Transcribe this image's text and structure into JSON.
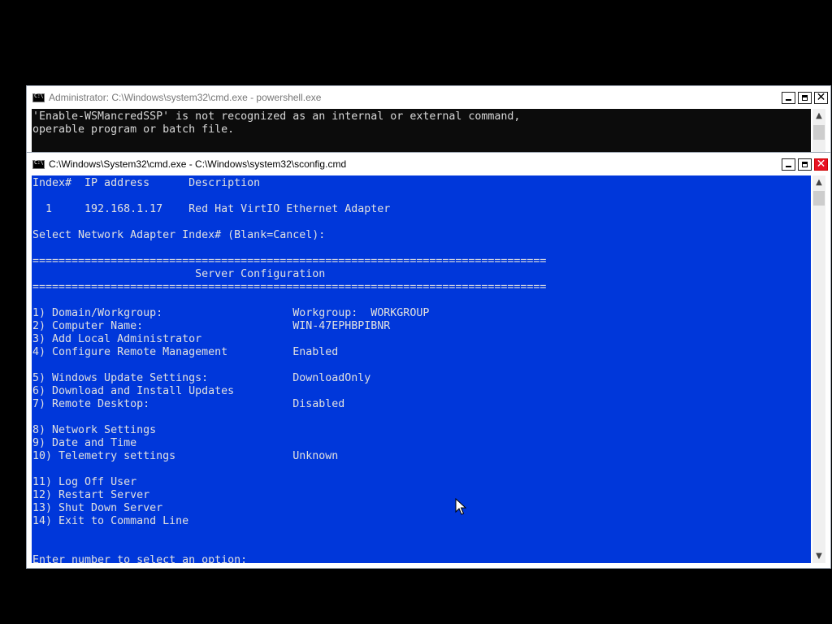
{
  "background_window": {
    "title": "Administrator: C:\\Windows\\system32\\cmd.exe - powershell.exe",
    "lines": [
      "'Enable-WSMancredSSP' is not recognized as an internal or external command,",
      "operable program or batch file."
    ],
    "colors": {
      "background": "#0c0c0c",
      "text": "#d8d8d8"
    }
  },
  "front_window": {
    "title": "C:\\Windows\\System32\\cmd.exe - C:\\Windows\\system32\\sconfig.cmd",
    "lines": [
      "Index#  IP address      Description",
      "",
      "  1     192.168.1.17    Red Hat VirtIO Ethernet Adapter",
      "",
      "Select Network Adapter Index# (Blank=Cancel):",
      "",
      "===============================================================================",
      "                         Server Configuration",
      "===============================================================================",
      "",
      "1) Domain/Workgroup:                    Workgroup:  WORKGROUP",
      "2) Computer Name:                       WIN-47EPHBPIBNR",
      "3) Add Local Administrator",
      "4) Configure Remote Management          Enabled",
      "",
      "5) Windows Update Settings:             DownloadOnly",
      "6) Download and Install Updates",
      "7) Remote Desktop:                      Disabled",
      "",
      "8) Network Settings",
      "9) Date and Time",
      "10) Telemetry settings                  Unknown",
      "",
      "11) Log Off User",
      "12) Restart Server",
      "13) Shut Down Server",
      "14) Exit to Command Line",
      "",
      "",
      "Enter number to select an option:"
    ],
    "colors": {
      "background": "#0037da",
      "text": "#e0e0e0",
      "close_button": "#e81123"
    }
  },
  "window_controls": {
    "minimize_icon": "minimize-icon",
    "maximize_icon": "maximize-icon",
    "close_icon": "close-icon",
    "close_glyph": "✕"
  },
  "scrollbar": {
    "up_glyph": "▲",
    "down_glyph": "▼"
  }
}
